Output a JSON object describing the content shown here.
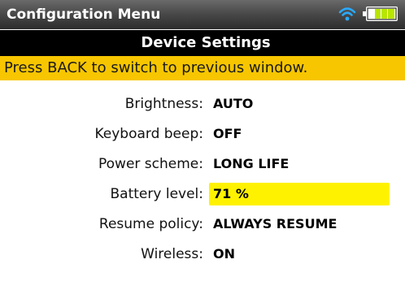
{
  "titlebar": {
    "title": "Configuration Menu",
    "wifi_icon": "wifi-icon",
    "battery_icon": "battery-icon",
    "wifi_color": "#29aaff",
    "battery_level_color": "#b8e600"
  },
  "subheader": {
    "title": "Device Settings"
  },
  "hint": {
    "text": "Press BACK to switch to previous window."
  },
  "settings": [
    {
      "label": "Brightness:",
      "value": "AUTO"
    },
    {
      "label": "Keyboard beep:",
      "value": "OFF"
    },
    {
      "label": "Power scheme:",
      "value": "LONG LIFE"
    },
    {
      "label": "Battery level:",
      "value": "71 %",
      "selected": true
    },
    {
      "label": "Resume policy:",
      "value": "ALWAYS RESUME"
    },
    {
      "label": "Wireless:",
      "value": "ON"
    }
  ],
  "colors": {
    "hint_background": "#f7c600",
    "selection_highlight": "#fff200",
    "subheader_background": "#000000"
  }
}
